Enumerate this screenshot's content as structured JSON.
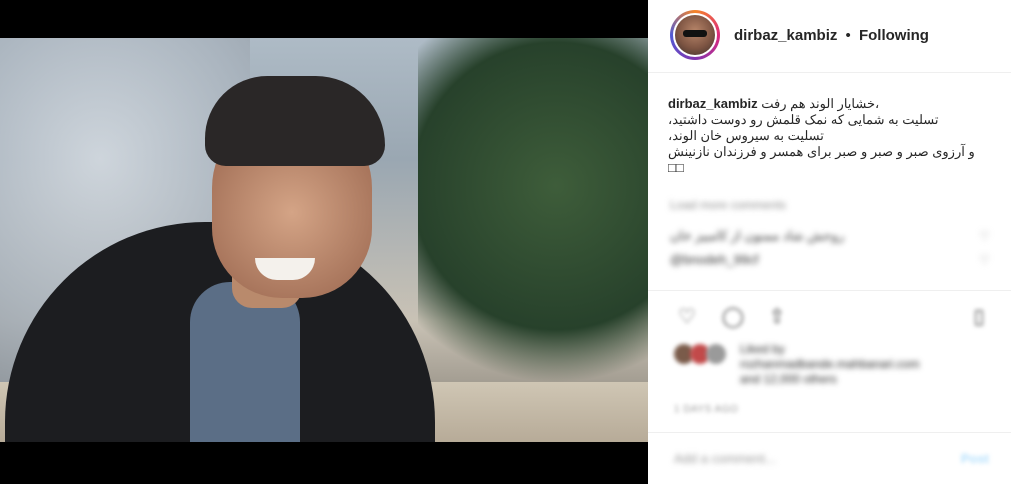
{
  "post": {
    "username": "dirbaz_kambiz",
    "separator": "•",
    "follow_status": "Following",
    "caption_user": "dirbaz_kambiz",
    "caption_first": "خشایار الوند هم رفت،",
    "caption_lines": [
      "تسلیت به شمایی که نمک قلمش رو دوست داشتید،",
      "تسلیت به سیروس خان الوند،",
      "و آرزوی صبر و صبر و صبر برای همسر و فرزندان نازنینش",
      "□□"
    ]
  },
  "comments": {
    "header": "Load more comments",
    "items": [
      {
        "text": "روحش شاد ممنون از کامبیز خان"
      },
      {
        "text": "@bnodeh_99cf"
      }
    ]
  },
  "actions": {
    "like_icon": "heart-icon",
    "comment_icon": "comment-icon",
    "share_icon": "share-icon",
    "save_icon": "bookmark-icon"
  },
  "likes": {
    "liked_by_label": "Liked by",
    "liked_by_user": "rozhanmadbande.mahbanari.com",
    "and_others": "and 12,000 others"
  },
  "time_ago": "1 DAYS AGO",
  "add_comment": {
    "placeholder": "Add a comment...",
    "post_label": "Post"
  }
}
